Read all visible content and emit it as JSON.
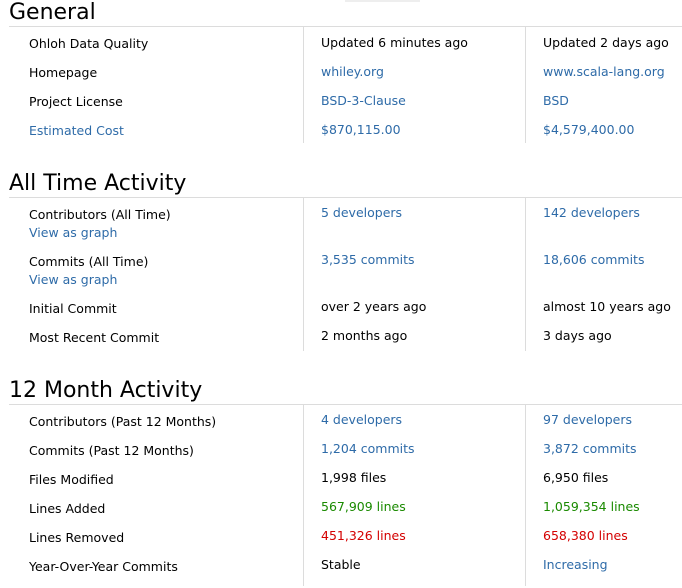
{
  "general": {
    "title": "General",
    "rows": [
      {
        "label": "Ohloh Data Quality",
        "a": "Updated 6 minutes ago",
        "b": "Updated 2 days ago"
      },
      {
        "label": "Homepage",
        "a": "whiley.org",
        "b": "www.scala-lang.org"
      },
      {
        "label": "Project License",
        "a": "BSD-3-Clause",
        "b": "BSD"
      },
      {
        "label": "Estimated Cost",
        "a": "$870,115.00",
        "b": "$4,579,400.00"
      }
    ]
  },
  "all_time": {
    "title": "All Time Activity",
    "view_graph": "View as graph",
    "rows": [
      {
        "label": "Contributors (All Time)",
        "a": "5 developers",
        "b": "142 developers"
      },
      {
        "label": "Commits (All Time)",
        "a": "3,535 commits",
        "b": "18,606 commits"
      },
      {
        "label": "Initial Commit",
        "a": "over 2 years ago",
        "b": "almost 10 years ago"
      },
      {
        "label": "Most Recent Commit",
        "a": "2 months ago",
        "b": "3 days ago"
      }
    ]
  },
  "twelve_month": {
    "title": "12 Month Activity",
    "rows": [
      {
        "label": "Contributors (Past 12 Months)",
        "a": "4 developers",
        "b": "97 developers"
      },
      {
        "label": "Commits (Past 12 Months)",
        "a": "1,204 commits",
        "b": "3,872 commits"
      },
      {
        "label": "Files Modified",
        "a": "1,998 files",
        "b": "6,950 files"
      },
      {
        "label": "Lines Added",
        "a": "567,909 lines",
        "b": "1,059,354 lines"
      },
      {
        "label": "Lines Removed",
        "a": "451,326 lines",
        "b": "658,380 lines"
      },
      {
        "label": "Year-Over-Year Commits",
        "a": "Stable",
        "b": "Increasing"
      }
    ]
  },
  "colors": {
    "link": "#2e6ba8",
    "added": "#1a8a00",
    "removed": "#d40000",
    "rule": "#dcdcdc"
  }
}
